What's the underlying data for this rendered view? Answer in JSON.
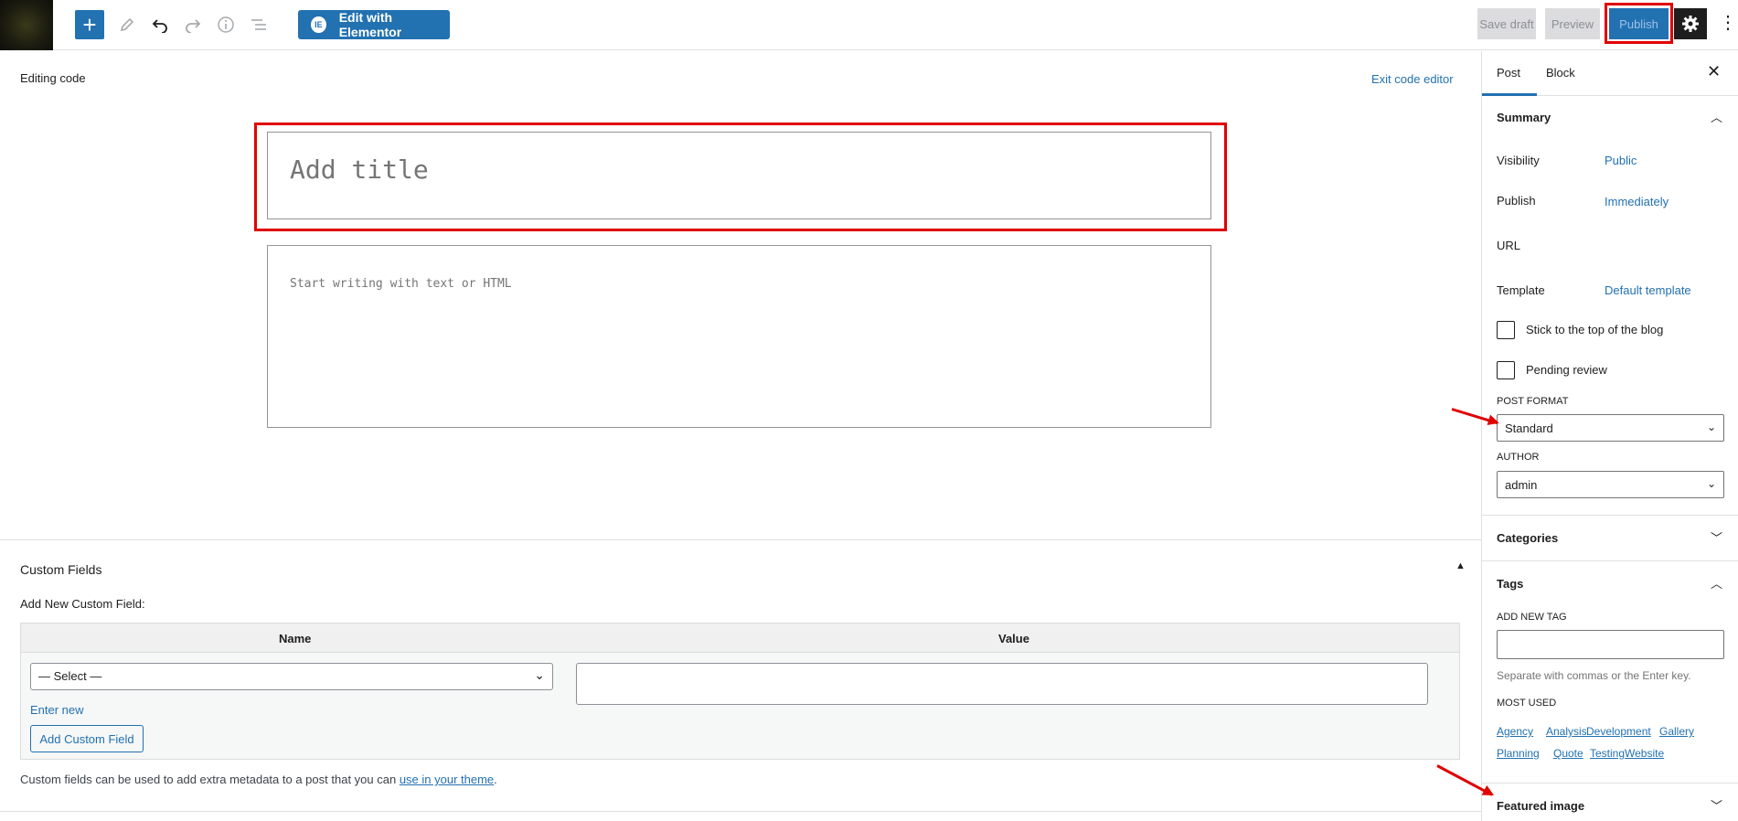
{
  "toolbar": {
    "add_block_glyph": "+",
    "edit_with_elementor": "Edit with Elementor",
    "elementor_logo": "IE",
    "save_draft": "Save draft",
    "preview": "Preview",
    "publish": "Publish"
  },
  "editor": {
    "mode_label": "Editing code",
    "exit_code_editor": "Exit code editor",
    "title_placeholder": "Add title",
    "content_placeholder": "Start writing with text or HTML"
  },
  "custom_fields": {
    "title": "Custom Fields",
    "add_new_label": "Add New Custom Field:",
    "col_name": "Name",
    "col_value": "Value",
    "select_default": "— Select —",
    "enter_new": "Enter new",
    "add_button": "Add Custom Field",
    "description_prefix": "Custom fields can be used to add extra metadata to a post that you can ",
    "description_link": "use in your theme",
    "description_suffix": "."
  },
  "sidebar": {
    "tabs": [
      {
        "label": "Post",
        "active": true
      },
      {
        "label": "Block",
        "active": false
      }
    ],
    "summary": {
      "title": "Summary",
      "rows": [
        {
          "label": "Visibility",
          "value": "Public"
        },
        {
          "label": "Publish",
          "value": "Immediately"
        },
        {
          "label": "URL",
          "value": ""
        },
        {
          "label": "Template",
          "value": "Default template"
        }
      ],
      "checkboxes": [
        {
          "label": "Stick to the top of the blog",
          "checked": false
        },
        {
          "label": "Pending review",
          "checked": false
        }
      ],
      "post_format_label": "POST FORMAT",
      "post_format_value": "Standard",
      "author_label": "AUTHOR",
      "author_value": "admin"
    },
    "categories_title": "Categories",
    "tags": {
      "title": "Tags",
      "add_new_label": "ADD NEW TAG",
      "help": "Separate with commas or the Enter key.",
      "most_used_label": "MOST USED",
      "most_used": [
        "Agency",
        "Analysis",
        "Development",
        "Gallery",
        "Planning",
        "Quote",
        "Testing",
        "Website"
      ]
    },
    "featured_image_title": "Featured image"
  },
  "colors": {
    "accent": "#2271b1",
    "highlight": "#e00000"
  }
}
